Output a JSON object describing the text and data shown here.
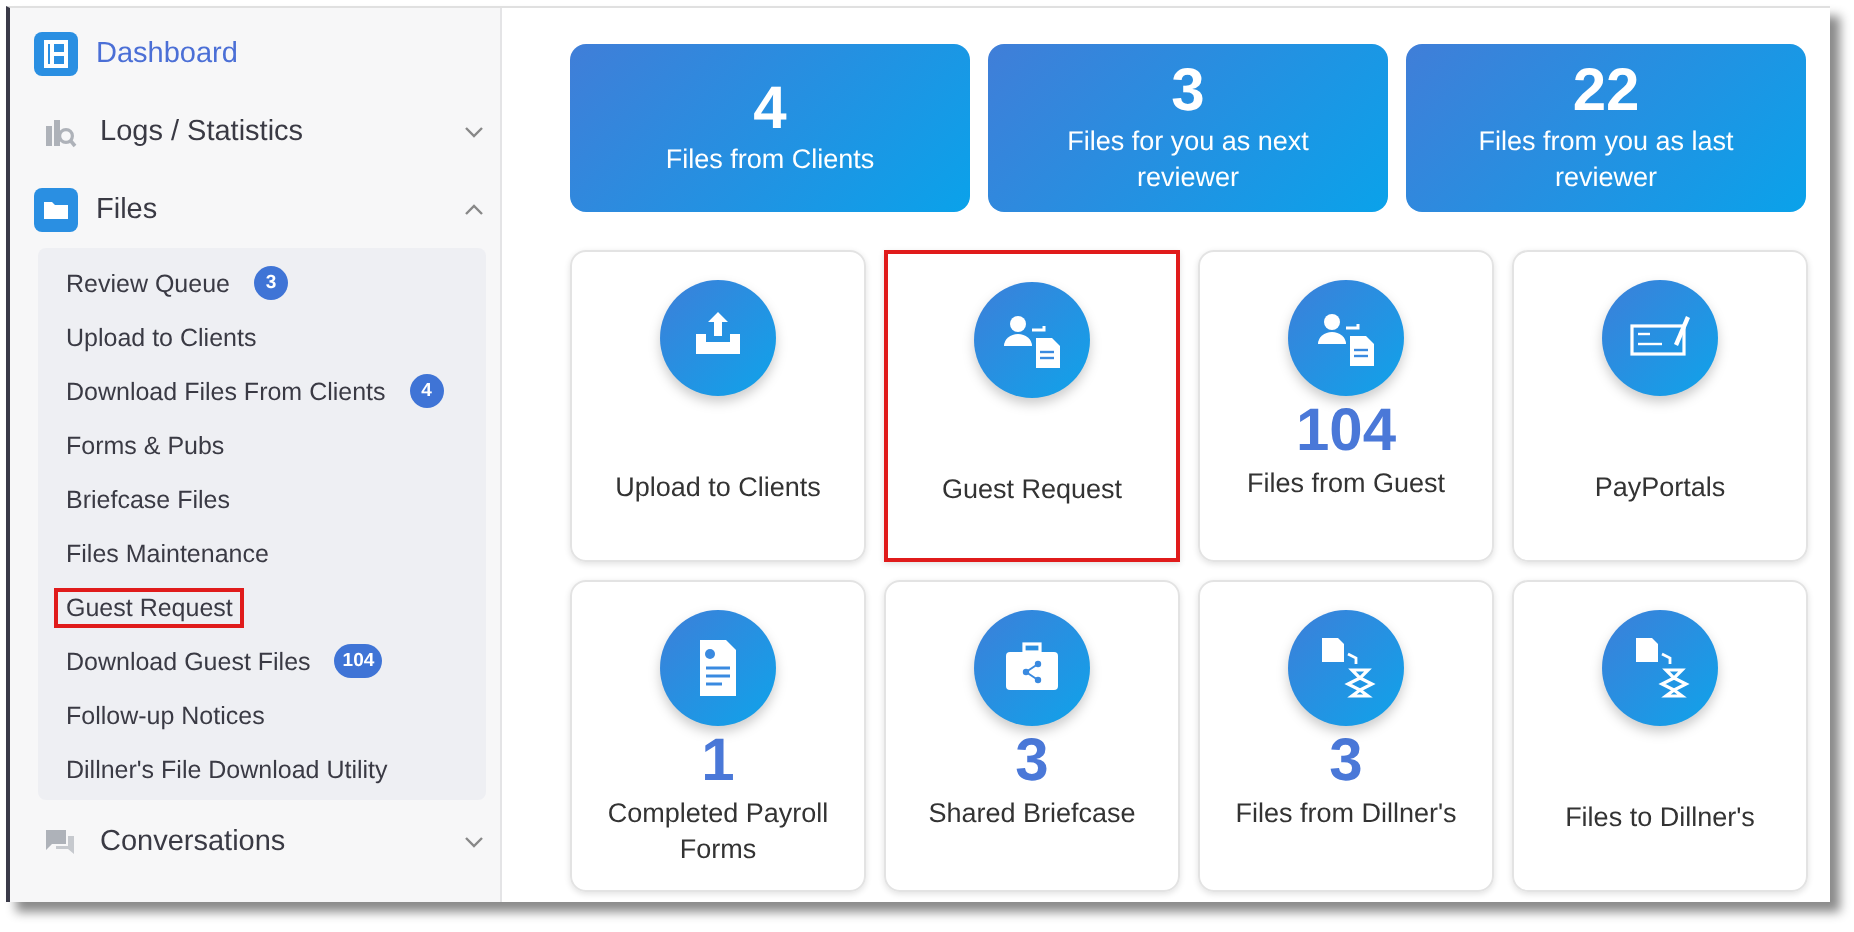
{
  "sidebar": {
    "items": [
      {
        "label": "Dashboard",
        "selected": true
      },
      {
        "label": "Logs / Statistics",
        "selected": false,
        "expanded": false
      },
      {
        "label": "Files",
        "selected": false,
        "expanded": true,
        "children": [
          {
            "label": "Review Queue",
            "badge": "3",
            "highlighted": false
          },
          {
            "label": "Upload to Clients",
            "highlighted": false
          },
          {
            "label": "Download Files From Clients",
            "badge": "4",
            "highlighted": false
          },
          {
            "label": "Forms & Pubs",
            "highlighted": false
          },
          {
            "label": "Briefcase Files",
            "highlighted": false
          },
          {
            "label": "Files Maintenance",
            "highlighted": false
          },
          {
            "label": "Guest Request",
            "highlighted": true
          },
          {
            "label": "Download Guest Files",
            "badge": "104",
            "highlighted": false
          },
          {
            "label": "Follow-up Notices",
            "highlighted": false
          },
          {
            "label": "Dillner's File Download Utility",
            "highlighted": false
          }
        ]
      },
      {
        "label": "Conversations",
        "selected": false,
        "expanded": false
      }
    ]
  },
  "stats": [
    {
      "count": "4",
      "label": "Files from Clients"
    },
    {
      "count": "3",
      "label": "Files for you as next reviewer"
    },
    {
      "count": "22",
      "label": "Files from you as last reviewer"
    }
  ],
  "tiles": [
    {
      "label": "Upload to Clients",
      "highlighted": false
    },
    {
      "label": "Guest Request",
      "highlighted": true
    },
    {
      "count": "104",
      "label": "Files from Guest",
      "highlighted": false
    },
    {
      "label": "PayPortals",
      "highlighted": false
    },
    {
      "count": "1",
      "label": "Completed Payroll Forms",
      "highlighted": false
    },
    {
      "count": "3",
      "label": "Shared Briefcase",
      "highlighted": false
    },
    {
      "count": "3",
      "label": "Files from Dillner's",
      "highlighted": false
    },
    {
      "label": "Files to Dillner's",
      "highlighted": false
    }
  ]
}
